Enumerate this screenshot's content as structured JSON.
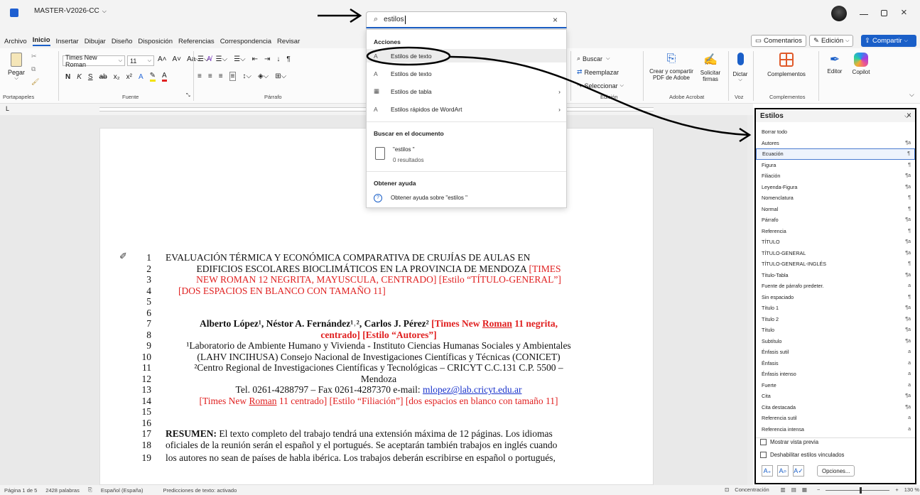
{
  "title_bar": {
    "doc_name": "MASTER-V2026-CC"
  },
  "search": {
    "value": "estilos",
    "clear": "×"
  },
  "menu_tabs": [
    "Archivo",
    "Inicio",
    "Insertar",
    "Dibujar",
    "Diseño",
    "Disposición",
    "Referencias",
    "Correspondencia",
    "Revisar"
  ],
  "right_buttons": {
    "comments": "Comentarios",
    "editing": "Edición",
    "share": "Compartir"
  },
  "ribbon": {
    "paste": "Pegar",
    "font_name": "Times New Roman",
    "font_size": "11",
    "groups": {
      "clipboard": "Portapapeles",
      "font": "Fuente",
      "paragraph": "Párrafo",
      "editing": "Edición",
      "acrobat": "Adobe Acrobat",
      "voice": "Voz",
      "addins": "Complementos"
    },
    "find": "Buscar",
    "replace": "Reemplazar",
    "select": "Seleccionar",
    "acrobat1": "Crear y compartir",
    "acrobat1b": "PDF de Adobe",
    "acrobat2": "Solicitar",
    "acrobat2b": "firmas",
    "dictate": "Dictar",
    "addins": "Complementos",
    "editor": "Editor",
    "copilot": "Copilot"
  },
  "dropdown": {
    "h_actions": "Acciones",
    "actions": [
      "Estilos de texto",
      "Estilos de texto",
      "Estilos de tabla",
      "Estilos rápidos de WordArt"
    ],
    "h_search": "Buscar en el documento",
    "search_term": "\"estilos \"",
    "search_results": "0 resultados",
    "h_help": "Obtener ayuda",
    "help_item": "Obtener ayuda sobre \"estilos \""
  },
  "styles_pane": {
    "title": "Estilos",
    "items": [
      {
        "name": "Borrar todo",
        "mark": ""
      },
      {
        "name": "Autores",
        "mark": "¶a"
      },
      {
        "name": "Ecuación",
        "mark": "¶"
      },
      {
        "name": "Figura",
        "mark": "¶"
      },
      {
        "name": "Filiación",
        "mark": "¶a"
      },
      {
        "name": "Leyenda-Figura",
        "mark": "¶a"
      },
      {
        "name": "Nomenclatura",
        "mark": "¶"
      },
      {
        "name": "Normal",
        "mark": "¶"
      },
      {
        "name": "Párrafo",
        "mark": "¶a"
      },
      {
        "name": "Referencia",
        "mark": "¶"
      },
      {
        "name": "TÍTULO",
        "mark": "¶a"
      },
      {
        "name": "TÍTULO-GENERAL",
        "mark": "¶a"
      },
      {
        "name": "TÍTULO-GENERAL-INGLÉS",
        "mark": "¶"
      },
      {
        "name": "Título-Tabla",
        "mark": "¶a"
      },
      {
        "name": "Fuente de párrafo predeter.",
        "mark": "a"
      },
      {
        "name": "Sin espaciado",
        "mark": "¶"
      },
      {
        "name": "Título 1",
        "mark": "¶a"
      },
      {
        "name": "Título 2",
        "mark": "¶a"
      },
      {
        "name": "Título",
        "mark": "¶a"
      },
      {
        "name": "Subtítulo",
        "mark": "¶a"
      },
      {
        "name": "Énfasis sutil",
        "mark": "a"
      },
      {
        "name": "Énfasis",
        "mark": "a"
      },
      {
        "name": "Énfasis intenso",
        "mark": "a"
      },
      {
        "name": "Fuerte",
        "mark": "a"
      },
      {
        "name": "Cita",
        "mark": "¶a"
      },
      {
        "name": "Cita destacada",
        "mark": "¶a"
      },
      {
        "name": "Referencia sutil",
        "mark": "a"
      },
      {
        "name": "Referencia intensa",
        "mark": "a"
      }
    ],
    "show_preview": "Mostrar vista previa",
    "disable_linked": "Deshabilitar estilos vinculados",
    "options": "Opciones..."
  },
  "doc": {
    "title1": "EVALUACIÓN TÉRMICA Y ECONÓMICA COMPARATIVA DE CRUJÍAS DE AULAS EN",
    "title2a": "EDIFICIOS ESCOLARES BIOCLIMÁTICOS EN LA PROVINCIA DE MENDOZA ",
    "title2b": "[TIMES",
    "title3": "NEW ROMAN 12 NEGRITA, MAYUSCULA, CENTRADO] [Estilo “TÍTULO-GENERAL”]",
    "title4": "[DOS ESPACIOS EN BLANCO CON TAMAÑO 11]",
    "authors_a": "Alberto López¹, Néstor A. Fernández¹˒², Carlos J. Pérez² ",
    "authors_b1": "[Times New ",
    "authors_b2": "Roman",
    "authors_b3": " 11 negrita,",
    "authors_c": "centrado] [Estilo “Autores”]",
    "aff1": "¹Laboratorio de Ambiente Humano y Vivienda - Instituto Ciencias Humanas Sociales y Ambientales",
    "aff2": "(LAHV INCIHUSA) Consejo Nacional de Investigaciones Científicas y Técnicas (CONICET)",
    "aff3": "²Centro Regional de Investigaciones Científicas y Tecnológicas – CRICYT C.C.131 C.P. 5500 –",
    "aff4": "Mendoza",
    "tel": "Tel. 0261-4288797 – Fax 0261-4287370  e-mail: ",
    "email": "mlopez@lab.cricyt.edu.ar",
    "note1": "[Times New ",
    "note2": "Roman",
    "note3": " 11 centrado] [Estilo “Filiación”] [dos espacios en blanco con tamaño 11]",
    "res_label": "RESUMEN:",
    "res1": " El texto completo del trabajo tendrá una extensión máxima de 12 páginas. Los idiomas",
    "res2": "oficiales de la reunión serán el español y el portugués. Se aceptarán también trabajos en inglés cuando",
    "res3": "los autores no sean de países de habla ibérica. Los trabajos deberán escribirse en español o portugués,",
    "line_numbers": [
      "1",
      "2",
      "3",
      "4",
      "5",
      "6",
      "7",
      "8",
      "9",
      "10",
      "11",
      "12",
      "13",
      "14",
      "15",
      "16",
      "17",
      "18",
      "19"
    ]
  },
  "status": {
    "page": "Página 1 de 5",
    "words": "2428 palabras",
    "lang": "Español (España)",
    "predict": "Predicciones de texto: activado",
    "focus": "Concentración",
    "zoom": "130 %"
  }
}
